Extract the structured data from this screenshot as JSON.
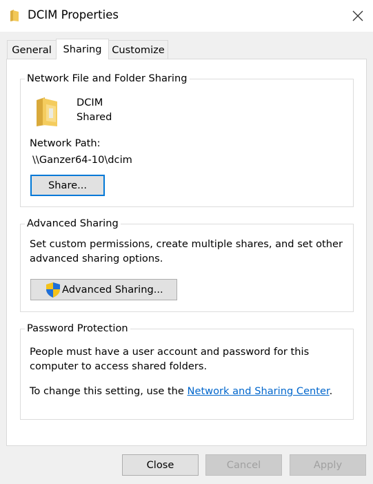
{
  "window": {
    "title": "DCIM Properties",
    "icon": "folder-icon",
    "close_icon": "close-icon"
  },
  "tabs": [
    {
      "label": "General",
      "active": false
    },
    {
      "label": "Sharing",
      "active": true
    },
    {
      "label": "Customize",
      "active": false
    }
  ],
  "network_sharing": {
    "group_title": "Network File and Folder Sharing",
    "folder_name": "DCIM",
    "folder_status": "Shared",
    "path_label": "Network Path:",
    "path_value": "\\\\Ganzer64-10\\dcim",
    "share_button": "Share..."
  },
  "advanced_sharing": {
    "group_title": "Advanced Sharing",
    "description_line1": "Set custom permissions, create multiple shares, and set other",
    "description_line2": "advanced sharing options.",
    "button_label": "Advanced Sharing...",
    "button_icon": "uac-shield-icon"
  },
  "password_protection": {
    "group_title": "Password Protection",
    "line1": "People must have a user account and password for this",
    "line2": "computer to access shared folders.",
    "line3_prefix": "To change this setting, use the ",
    "link_text": "Network and Sharing Center",
    "line3_suffix": "."
  },
  "footer": {
    "close": "Close",
    "cancel": "Cancel",
    "apply": "Apply"
  },
  "colors": {
    "accent": "#0078d7",
    "link": "#0066cc",
    "folder": "#e8b843"
  }
}
